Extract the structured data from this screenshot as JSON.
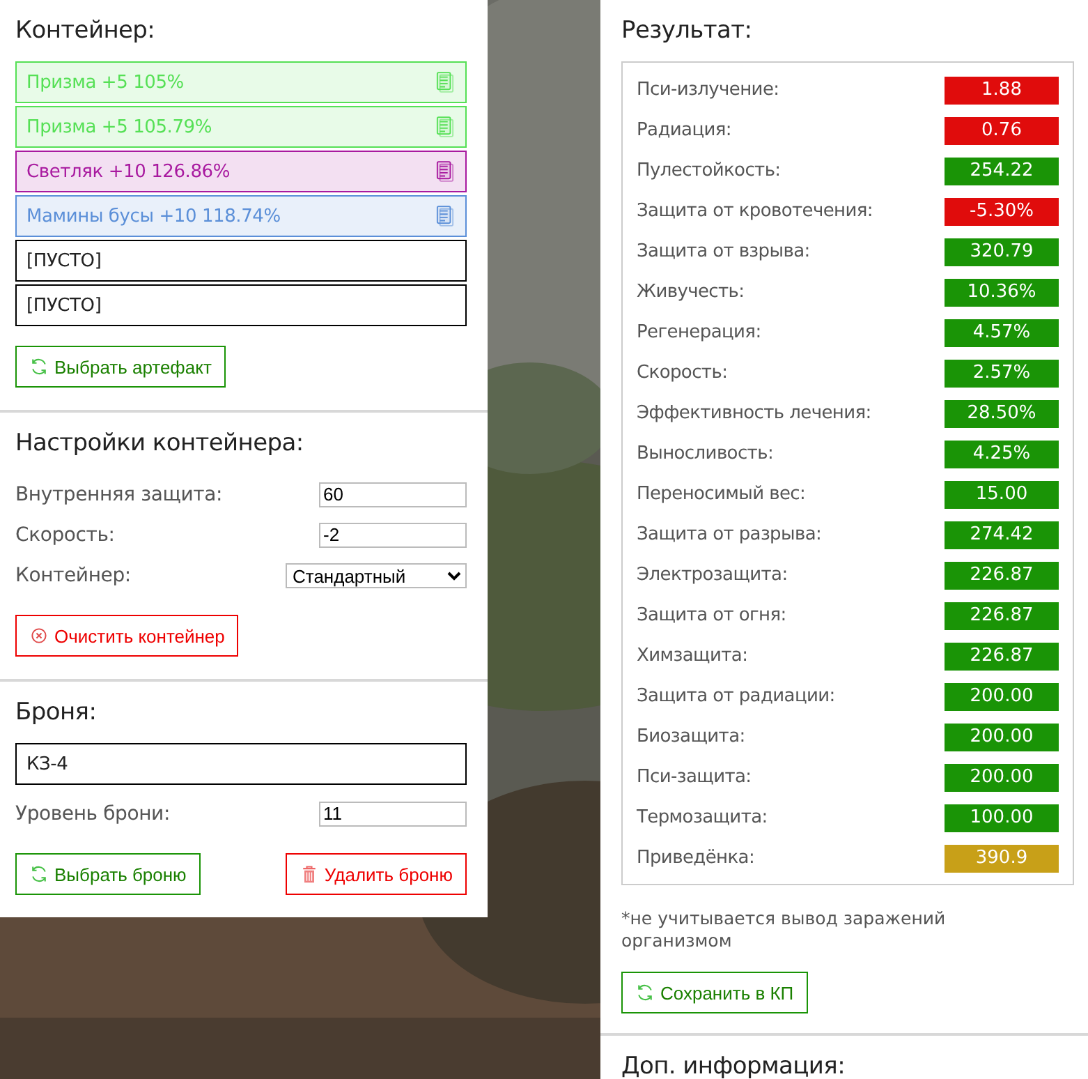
{
  "container": {
    "title": "Контейнер:",
    "slots": [
      {
        "kind": "artifact",
        "text": "Призма +5 105%",
        "color": "#55e055"
      },
      {
        "kind": "artifact",
        "text": "Призма +5 105.79%",
        "color": "#55e055"
      },
      {
        "kind": "artifact",
        "text": "Светляк +10 126.86%",
        "color": "#a8199f"
      },
      {
        "kind": "artifact",
        "text": "Мамины бусы +10 118.74%",
        "color": "#5b8fd8"
      },
      {
        "kind": "empty",
        "text": "[ПУСТО]"
      },
      {
        "kind": "empty",
        "text": "[ПУСТО]"
      }
    ],
    "select_button": "Выбрать артефакт"
  },
  "settings": {
    "title": "Настройки контейнера:",
    "fields": [
      {
        "kind": "input",
        "label": "Внутренняя защита:",
        "value": "60"
      },
      {
        "kind": "input",
        "label": "Скорость:",
        "value": "-2"
      },
      {
        "kind": "select",
        "label": "Контейнер:",
        "value": "Стандартный"
      }
    ],
    "clear_button": "Очистить контейнер"
  },
  "armor": {
    "title": "Броня:",
    "name": "КЗ-4",
    "level_label": "Уровень брони:",
    "level_value": "11",
    "select_button": "Выбрать броню",
    "delete_button": "Удалить броню"
  },
  "result": {
    "title": "Результат:",
    "stats": [
      {
        "label": "Пси-излучение:",
        "value": "1.88",
        "color": "#e00c0c"
      },
      {
        "label": "Радиация:",
        "value": "0.76",
        "color": "#e00c0c"
      },
      {
        "label": "Пулестойкость:",
        "value": "254.22",
        "color": "#1a9406"
      },
      {
        "label": "Защита от кровотечения:",
        "value": "-5.30%",
        "color": "#e00c0c"
      },
      {
        "label": "Защита от взрыва:",
        "value": "320.79",
        "color": "#1a9406"
      },
      {
        "label": "Живучесть:",
        "value": "10.36%",
        "color": "#1a9406"
      },
      {
        "label": "Регенерация:",
        "value": "4.57%",
        "color": "#1a9406"
      },
      {
        "label": "Скорость:",
        "value": "2.57%",
        "color": "#1a9406"
      },
      {
        "label": "Эффективность лечения:",
        "value": "28.50%",
        "color": "#1a9406"
      },
      {
        "label": "Выносливость:",
        "value": "4.25%",
        "color": "#1a9406"
      },
      {
        "label": "Переносимый вес:",
        "value": "15.00",
        "color": "#1a9406"
      },
      {
        "label": "Защита от разрыва:",
        "value": "274.42",
        "color": "#1a9406"
      },
      {
        "label": "Электрозащита:",
        "value": "226.87",
        "color": "#1a9406"
      },
      {
        "label": "Защита от огня:",
        "value": "226.87",
        "color": "#1a9406"
      },
      {
        "label": "Химзащита:",
        "value": "226.87",
        "color": "#1a9406"
      },
      {
        "label": "Защита от радиации:",
        "value": "200.00",
        "color": "#1a9406"
      },
      {
        "label": "Биозащита:",
        "value": "200.00",
        "color": "#1a9406"
      },
      {
        "label": "Пси-защита:",
        "value": "200.00",
        "color": "#1a9406"
      },
      {
        "label": "Термозащита:",
        "value": "100.00",
        "color": "#1a9406"
      },
      {
        "label": "Приведёнка:",
        "value": "390.9",
        "color": "#c8a018"
      }
    ],
    "note": "*не учитывается вывод заражений организмом",
    "save_button": "Сохранить в КП"
  },
  "extra": {
    "title": "Доп. информация:"
  }
}
